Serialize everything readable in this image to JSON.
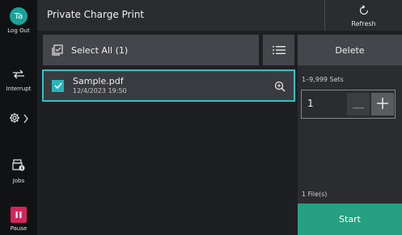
{
  "header": {
    "title": "Private Charge Print",
    "refresh_label": "Refresh"
  },
  "rail": {
    "avatar_initials": "Ta",
    "logout_label": "Log Out",
    "interrupt_label": "Interrupt",
    "jobs_label": "Jobs",
    "pause_label": "Pause"
  },
  "toolbar": {
    "select_all_label": "Select All (1)"
  },
  "files": [
    {
      "name": "Sample.pdf",
      "date": "12/4/2023 19:50",
      "checked": true
    }
  ],
  "panel": {
    "delete_label": "Delete",
    "sets_range": "1–9,999 Sets",
    "quantity": "1",
    "files_count": "1 File(s)",
    "start_label": "Start"
  },
  "colors": {
    "accent_teal": "#30c2c4",
    "start_green": "#25a081",
    "pause_red": "#d6245c",
    "avatar_teal": "#1aa39a"
  }
}
